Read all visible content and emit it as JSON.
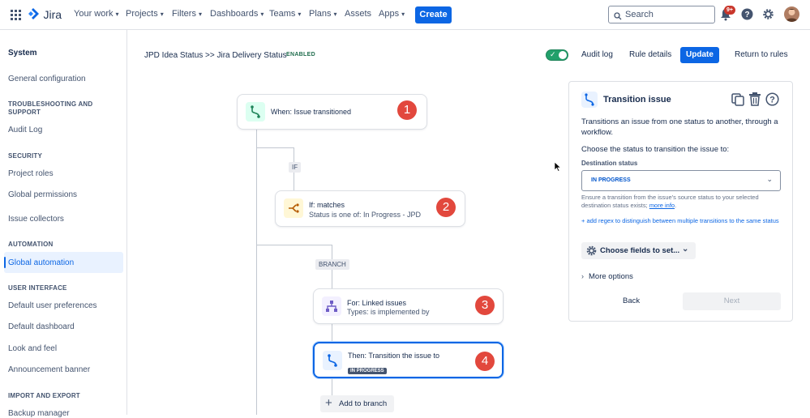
{
  "topbar": {
    "logo_text": "Jira",
    "nav": [
      "Your work",
      "Projects",
      "Filters",
      "Dashboards",
      "Teams",
      "Plans",
      "Assets",
      "Apps"
    ],
    "create_label": "Create",
    "search_placeholder": "Search",
    "notifications_badge": "9+"
  },
  "sidebar": {
    "title": "System",
    "items": {
      "general_configuration": "General configuration",
      "troubleshooting_heading": "TROUBLESHOOTING AND SUPPORT",
      "audit_log": "Audit Log",
      "security_heading": "SECURITY",
      "project_roles": "Project roles",
      "global_permissions": "Global permissions",
      "issue_collectors": "Issue collectors",
      "automation_heading": "AUTOMATION",
      "global_automation": "Global automation",
      "user_interface_heading": "USER INTERFACE",
      "default_user_preferences": "Default user preferences",
      "default_dashboard": "Default dashboard",
      "look_and_feel": "Look and feel",
      "announcement_banner": "Announcement banner",
      "import_export_heading": "IMPORT AND EXPORT",
      "backup_manager": "Backup manager"
    }
  },
  "header": {
    "rule_name": "JPD Idea Status >> Jira Delivery Status",
    "status": "ENABLED",
    "audit_log": "Audit log",
    "rule_details": "Rule details",
    "update": "Update",
    "return_to_rules": "Return to rules"
  },
  "flow": {
    "trigger": {
      "title": "When: Issue transitioned",
      "number": "1"
    },
    "if_label": "IF",
    "condition": {
      "title": "If: matches",
      "subtitle": "Status is one of: In Progress - JPD",
      "number": "2"
    },
    "branch_label": "BRANCH",
    "branch": {
      "title": "For: Linked issues",
      "subtitle": "Types: is implemented by",
      "number": "3"
    },
    "action": {
      "title": "Then: Transition the issue to",
      "status": "IN PROGRESS",
      "number": "4"
    },
    "add_to_branch": "Add to branch"
  },
  "panel": {
    "title": "Transition issue",
    "description": "Transitions an issue from one status to another, through a workflow.",
    "choose_text": "Choose the status to transition the issue to:",
    "destination_label": "Destination status",
    "destination_value": "IN PROGRESS",
    "help_text": "Ensure a transition from the issue's source status to your selected destination status exists;",
    "more_info": "more info",
    "regex_link": "+ add regex to distinguish between multiple transitions to the same status",
    "choose_fields": "Choose fields to set...",
    "more_options": "More options",
    "back": "Back",
    "next": "Next"
  },
  "colors": {
    "accent": "#0c66e4",
    "step_number": "#e2483d",
    "toggle_on": "#22a06b"
  }
}
